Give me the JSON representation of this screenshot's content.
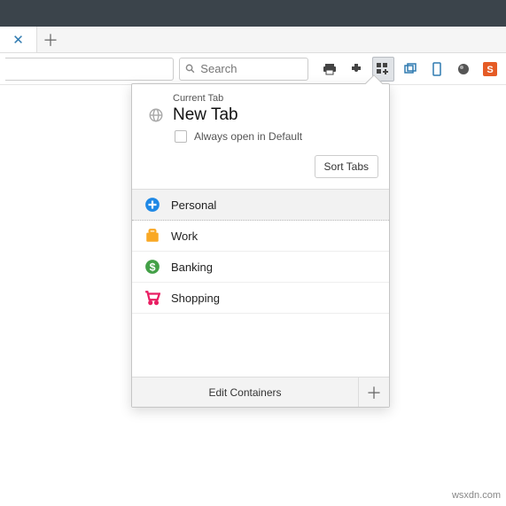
{
  "toolbar": {
    "search_placeholder": "Search"
  },
  "panel": {
    "current_tab_label": "Current Tab",
    "tab_title": "New Tab",
    "always_label": "Always open in Default",
    "sort_label": "Sort Tabs",
    "edit_label": "Edit Containers"
  },
  "containers": [
    {
      "label": "Personal",
      "icon": "plus-circle",
      "color": "#1e88e5"
    },
    {
      "label": "Work",
      "icon": "briefcase",
      "color": "#f9a825"
    },
    {
      "label": "Banking",
      "icon": "dollar-circle",
      "color": "#43a047"
    },
    {
      "label": "Shopping",
      "icon": "cart",
      "color": "#e91e63"
    }
  ],
  "watermark": "wsxdn.com"
}
